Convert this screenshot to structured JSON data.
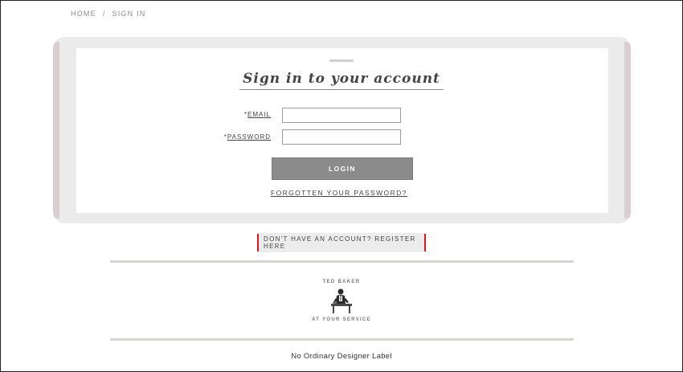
{
  "breadcrumb": {
    "items": [
      "HOME",
      "SIGN IN"
    ],
    "separator": "/"
  },
  "signin": {
    "title": "Sign in to your account",
    "email_required": "*",
    "email_label": "EMAIL",
    "email_value": "",
    "password_required": "*",
    "password_label": "PASSWORD",
    "password_value": "",
    "login_label": "LOGIN",
    "forgot_label": "FORGOTTEN YOUR PASSWORD?"
  },
  "register": {
    "label": "DON'T HAVE AN ACCOUNT? REGISTER HERE",
    "highlight_color": "#e0151b"
  },
  "brand": {
    "top_text": "TED BAKER",
    "bottom_text": "AT YOUR SERVICE",
    "illustration": "man-at-desk-illustration"
  },
  "footer": {
    "tagline": "No Ordinary Designer Label"
  },
  "colors": {
    "button_bg": "#8b8b8c",
    "panel_bg": "#ebebeb",
    "panel_edge": "#d9cfd1"
  }
}
